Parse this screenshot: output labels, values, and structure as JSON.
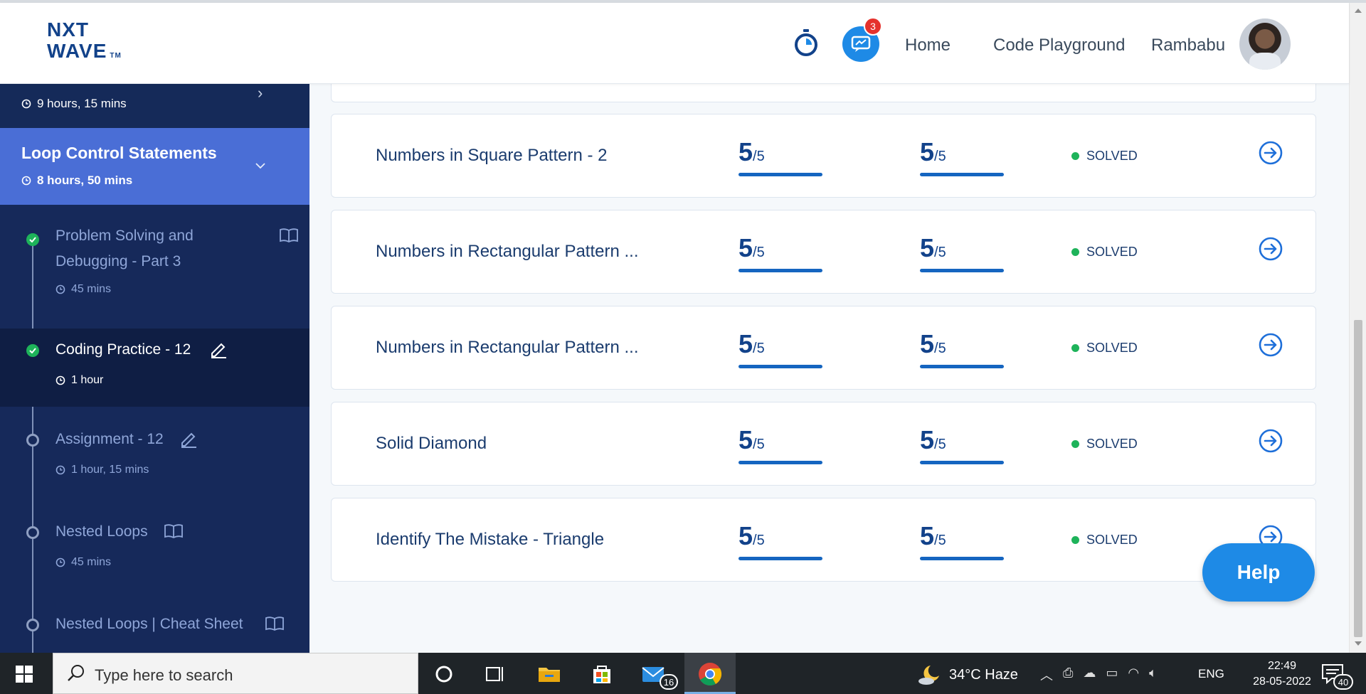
{
  "header": {
    "logo_line1": "NXT",
    "logo_line2": "WAVE",
    "logo_tm": "TM",
    "chat_badge": "3",
    "nav": {
      "home": "Home",
      "playground": "Code Playground"
    },
    "user_name": "Rambabu"
  },
  "sidebar": {
    "previous_section": {
      "duration": "9 hours, 15 mins"
    },
    "active_section": {
      "title": "Loop Control Statements",
      "duration": "8 hours, 50 mins"
    },
    "lessons": [
      {
        "name_line1": "Problem Solving and",
        "name_line2": "Debugging - Part 3",
        "duration": "45 mins",
        "status": "done",
        "type": "reading"
      },
      {
        "name_line1": "Coding Practice - 12",
        "name_line2": "",
        "duration": "1 hour",
        "status": "done",
        "type": "practice",
        "current": true
      },
      {
        "name_line1": "Assignment - 12",
        "name_line2": "",
        "duration": "1 hour, 15 mins",
        "status": "open",
        "type": "practice"
      },
      {
        "name_line1": "Nested Loops",
        "name_line2": "",
        "duration": "45 mins",
        "status": "open",
        "type": "reading"
      },
      {
        "name_line1": "Nested Loops | Cheat Sheet",
        "name_line2": "",
        "duration": "",
        "status": "open",
        "type": "reading"
      }
    ]
  },
  "questions": [
    {
      "name": "Numbers in Square Pattern - 2",
      "score1": "5",
      "total1": "/5",
      "progress1": 1.0,
      "score2": "5",
      "total2": "/5",
      "progress2": 1.0,
      "status": "SOLVED"
    },
    {
      "name": "Numbers in Rectangular Pattern ...",
      "score1": "5",
      "total1": "/5",
      "progress1": 1.0,
      "score2": "5",
      "total2": "/5",
      "progress2": 1.0,
      "status": "SOLVED"
    },
    {
      "name": "Numbers in Rectangular Pattern ...",
      "score1": "5",
      "total1": "/5",
      "progress1": 1.0,
      "score2": "5",
      "total2": "/5",
      "progress2": 1.0,
      "status": "SOLVED"
    },
    {
      "name": "Solid Diamond",
      "score1": "5",
      "total1": "/5",
      "progress1": 1.0,
      "score2": "5",
      "total2": "/5",
      "progress2": 1.0,
      "status": "SOLVED"
    },
    {
      "name": "Identify The Mistake - Triangle",
      "score1": "5",
      "total1": "/5",
      "progress1": 1.0,
      "score2": "5",
      "total2": "/5",
      "progress2": 1.0,
      "status": "SOLVED"
    }
  ],
  "help_label": "Help",
  "taskbar": {
    "search_placeholder": "Type here to search",
    "mail_badge": "16",
    "weather": "34°C  Haze",
    "lang": "ENG",
    "time": "22:49",
    "date": "28-05-2022",
    "notif_badge": "40"
  },
  "colors": {
    "brand_dark": "#12428a",
    "sidebar_bg": "#16295a",
    "sidebar_active": "#4a6ed6",
    "success": "#1eb35a",
    "accent": "#1e8ae6"
  }
}
